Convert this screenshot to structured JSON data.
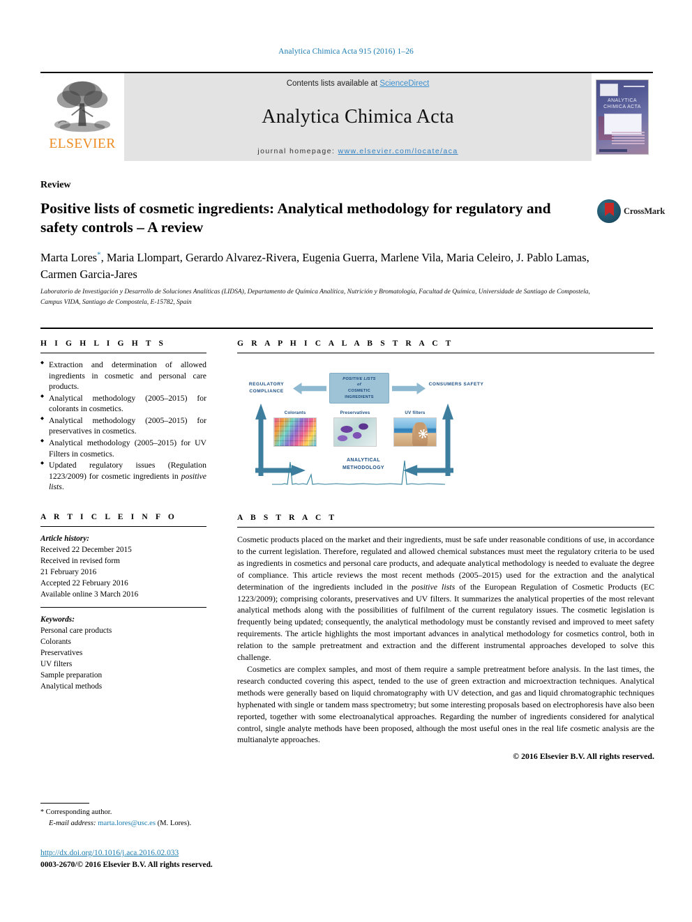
{
  "running_head": "Analytica Chimica Acta 915 (2016) 1–26",
  "masthead": {
    "publisher": "ELSEVIER",
    "contents_prefix": "Contents lists available at ",
    "contents_link": "ScienceDirect",
    "journal_title": "Analytica Chimica Acta",
    "homepage_prefix": "journal homepage: ",
    "homepage_url": "www.elsevier.com/locate/aca",
    "cover_title": "ANALYTICA CHIMICA ACTA"
  },
  "article": {
    "type": "Review",
    "title": "Positive lists of cosmetic ingredients: Analytical methodology for regulatory and safety controls – A review",
    "crossmark_label": "CrossMark",
    "authors": "Marta Lores*, Maria Llompart, Gerardo Alvarez-Rivera, Eugenia Guerra, Marlene Vila, Maria Celeiro, J. Pablo Lamas, Carmen Garcia-Jares",
    "affiliation": "Laboratorio de Investigación y Desarrollo de Soluciones Analíticas (LIDSA), Departamento de Química Analítica, Nutrición y Bromatología, Facultad de Química, Universidade de Santiago de Compostela, Campus VIDA, Santiago de Compostela, E-15782, Spain"
  },
  "highlights": {
    "heading": "H I G H L I G H T S",
    "items": [
      "Extraction and determination of allowed ingredients in cosmetic and personal care products.",
      "Analytical methodology (2005–2015) for colorants in cosmetics.",
      "Analytical methodology (2005–2015) for preservatives in cosmetics.",
      "Analytical methodology (2005–2015) for UV Filters in cosmetics.",
      "Updated regulatory issues (Regulation 1223/2009) for cosmetic ingredients in positive lists."
    ]
  },
  "article_info": {
    "heading": "A R T I C L E   I N F O",
    "history_label": "Article history:",
    "history": [
      "Received 22 December 2015",
      "Received in revised form",
      "21 February 2016",
      "Accepted 22 February 2016",
      "Available online 3 March 2016"
    ],
    "keywords_label": "Keywords:",
    "keywords": [
      "Personal care products",
      "Colorants",
      "Preservatives",
      "UV filters",
      "Sample preparation",
      "Analytical methods"
    ]
  },
  "graphical_abstract": {
    "heading": "G R A P H I C A L   A B S T R A C T",
    "center_line1": "POSITIVE LISTS",
    "center_line2": "of",
    "center_line3": "COSMETIC",
    "center_line4": "INGREDIENTS",
    "left_label": "REGULATORY COMPLIANCE",
    "right_label": "CONSUMERS SAFETY",
    "bottom_label": "ANALYTICAL METHODOLOGY",
    "thumbs": [
      {
        "caption": "Colorants"
      },
      {
        "caption": "Preservatives"
      },
      {
        "caption": "UV filters"
      }
    ]
  },
  "abstract": {
    "heading": "A B S T R A C T",
    "paragraph1_a": "Cosmetic products placed on the market and their ingredients, must be safe under reasonable conditions of use, in accordance to the current legislation. Therefore, regulated and allowed chemical substances must meet the regulatory criteria to be used as ingredients in cosmetics and personal care products, and adequate analytical methodology is needed to evaluate the degree of compliance. This article reviews the most recent methods (2005–2015) used for the extraction and the analytical determination of the ingredients included in the ",
    "paragraph1_em": "positive lists",
    "paragraph1_b": " of the European Regulation of Cosmetic Products (EC 1223/2009); comprising colorants, preservatives and UV filters. It summarizes the analytical properties of the most relevant analytical methods along with the possibilities of fulfilment of the current regulatory issues. The cosmetic legislation is frequently being updated; consequently, the analytical methodology must be constantly revised and improved to meet safety requirements. The article highlights the most important advances in analytical methodology for cosmetics control, both in relation to the sample pretreatment and extraction and the different instrumental approaches developed to solve this challenge.",
    "paragraph2": "Cosmetics are complex samples, and most of them require a sample pretreatment before analysis. In the last times, the research conducted covering this aspect, tended to the use of green extraction and microextraction techniques. Analytical methods were generally based on liquid chromatography with UV detection, and gas and liquid chromatographic techniques hyphenated with single or tandem mass spectrometry; but some interesting proposals based on electrophoresis have also been reported, together with some electroanalytical approaches. Regarding the number of ingredients considered for analytical control, single analyte methods have been proposed, although the most useful ones in the real life cosmetic analysis are the multianalyte approaches.",
    "copyright": "© 2016 Elsevier B.V. All rights reserved."
  },
  "footer": {
    "corresponding_star": "*",
    "corresponding_label": "Corresponding author.",
    "email_label": "E-mail address:",
    "email": "marta.lores@usc.es",
    "email_suffix": "(M. Lores).",
    "doi": "http://dx.doi.org/10.1016/j.aca.2016.02.033",
    "issn_line": "0003-2670/© 2016 Elsevier B.V. All rights reserved."
  },
  "colors": {
    "link_blue": "#1a7bb0",
    "elsevier_orange": "#ed8b21",
    "figure_blue": "#3d7d9e",
    "figure_light": "#9fc3d6"
  }
}
